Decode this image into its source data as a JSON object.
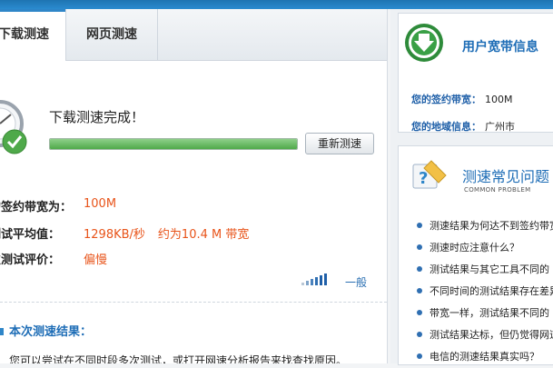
{
  "tabs": [
    {
      "label": "下载测速",
      "active": true
    },
    {
      "label": "网页测速",
      "active": false
    }
  ],
  "test": {
    "status": "下载测速完成！",
    "progress": 1.0,
    "retest_label": "重新测速",
    "rows": [
      {
        "label": "的签约带宽为：",
        "value": "100M",
        "extra": ""
      },
      {
        "label": "测试平均值：",
        "value": "1298KB/秒",
        "extra": "约为10.4 M 带宽"
      },
      {
        "label": "次测试评价：",
        "value": "偏慢",
        "extra": ""
      }
    ],
    "rating_level": "一般",
    "result_title": "本次测速结果：",
    "result_text": "您可以尝试在不同时段多次测试，或打开网速分析报告来找查找原因。"
  },
  "sidebar": {
    "broadband_title": "用户宽带信息",
    "plan_key": "您的签约带宽：",
    "plan_value": "100M",
    "region_key": "您的地域信息：",
    "region_value": "广州市",
    "faq_title": "测速常见问题",
    "faq_subtitle": "COMMON PROBLEM",
    "faq_items": [
      "测速结果为何达不到签约带宽",
      "测速时应注意什么？",
      "测试结果与其它工具不同的",
      "不同时间的测试结果存在差异",
      "带宽一样，测试结果不同的",
      "测试结果达标，但仍觉得网速慢",
      "电信的测速结果真实吗？"
    ]
  },
  "colors": {
    "accent": "#1e6db6",
    "value": "#e8541a",
    "progress": "#4fa94a"
  }
}
